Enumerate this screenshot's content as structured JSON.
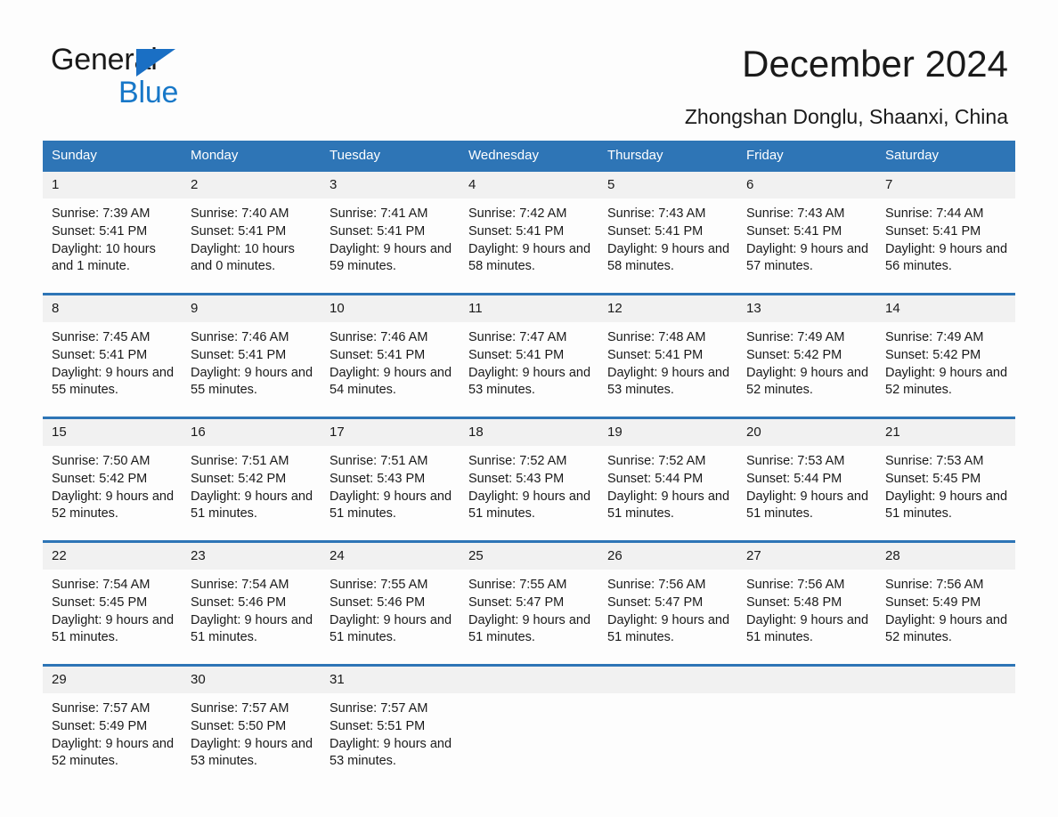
{
  "logo": {
    "word1": "General",
    "word2": "Blue",
    "triangle_color": "#1a6fc4",
    "word2_color": "#1878c8"
  },
  "header": {
    "title": "December 2024",
    "subtitle": "Zhongshan Donglu, Shaanxi, China"
  },
  "theme": {
    "header_band": "#2e75b6",
    "daynum_background": "#f1f1f1",
    "page_background": "#fdfdfd",
    "text": "#1a1a1a"
  },
  "calendar": {
    "weekday_headers": [
      "Sunday",
      "Monday",
      "Tuesday",
      "Wednesday",
      "Thursday",
      "Friday",
      "Saturday"
    ],
    "weeks": [
      [
        {
          "day": "1",
          "sunrise": "Sunrise: 7:39 AM",
          "sunset": "Sunset: 5:41 PM",
          "daylight": "Daylight: 10 hours and 1 minute."
        },
        {
          "day": "2",
          "sunrise": "Sunrise: 7:40 AM",
          "sunset": "Sunset: 5:41 PM",
          "daylight": "Daylight: 10 hours and 0 minutes."
        },
        {
          "day": "3",
          "sunrise": "Sunrise: 7:41 AM",
          "sunset": "Sunset: 5:41 PM",
          "daylight": "Daylight: 9 hours and 59 minutes."
        },
        {
          "day": "4",
          "sunrise": "Sunrise: 7:42 AM",
          "sunset": "Sunset: 5:41 PM",
          "daylight": "Daylight: 9 hours and 58 minutes."
        },
        {
          "day": "5",
          "sunrise": "Sunrise: 7:43 AM",
          "sunset": "Sunset: 5:41 PM",
          "daylight": "Daylight: 9 hours and 58 minutes."
        },
        {
          "day": "6",
          "sunrise": "Sunrise: 7:43 AM",
          "sunset": "Sunset: 5:41 PM",
          "daylight": "Daylight: 9 hours and 57 minutes."
        },
        {
          "day": "7",
          "sunrise": "Sunrise: 7:44 AM",
          "sunset": "Sunset: 5:41 PM",
          "daylight": "Daylight: 9 hours and 56 minutes."
        }
      ],
      [
        {
          "day": "8",
          "sunrise": "Sunrise: 7:45 AM",
          "sunset": "Sunset: 5:41 PM",
          "daylight": "Daylight: 9 hours and 55 minutes."
        },
        {
          "day": "9",
          "sunrise": "Sunrise: 7:46 AM",
          "sunset": "Sunset: 5:41 PM",
          "daylight": "Daylight: 9 hours and 55 minutes."
        },
        {
          "day": "10",
          "sunrise": "Sunrise: 7:46 AM",
          "sunset": "Sunset: 5:41 PM",
          "daylight": "Daylight: 9 hours and 54 minutes."
        },
        {
          "day": "11",
          "sunrise": "Sunrise: 7:47 AM",
          "sunset": "Sunset: 5:41 PM",
          "daylight": "Daylight: 9 hours and 53 minutes."
        },
        {
          "day": "12",
          "sunrise": "Sunrise: 7:48 AM",
          "sunset": "Sunset: 5:41 PM",
          "daylight": "Daylight: 9 hours and 53 minutes."
        },
        {
          "day": "13",
          "sunrise": "Sunrise: 7:49 AM",
          "sunset": "Sunset: 5:42 PM",
          "daylight": "Daylight: 9 hours and 52 minutes."
        },
        {
          "day": "14",
          "sunrise": "Sunrise: 7:49 AM",
          "sunset": "Sunset: 5:42 PM",
          "daylight": "Daylight: 9 hours and 52 minutes."
        }
      ],
      [
        {
          "day": "15",
          "sunrise": "Sunrise: 7:50 AM",
          "sunset": "Sunset: 5:42 PM",
          "daylight": "Daylight: 9 hours and 52 minutes."
        },
        {
          "day": "16",
          "sunrise": "Sunrise: 7:51 AM",
          "sunset": "Sunset: 5:42 PM",
          "daylight": "Daylight: 9 hours and 51 minutes."
        },
        {
          "day": "17",
          "sunrise": "Sunrise: 7:51 AM",
          "sunset": "Sunset: 5:43 PM",
          "daylight": "Daylight: 9 hours and 51 minutes."
        },
        {
          "day": "18",
          "sunrise": "Sunrise: 7:52 AM",
          "sunset": "Sunset: 5:43 PM",
          "daylight": "Daylight: 9 hours and 51 minutes."
        },
        {
          "day": "19",
          "sunrise": "Sunrise: 7:52 AM",
          "sunset": "Sunset: 5:44 PM",
          "daylight": "Daylight: 9 hours and 51 minutes."
        },
        {
          "day": "20",
          "sunrise": "Sunrise: 7:53 AM",
          "sunset": "Sunset: 5:44 PM",
          "daylight": "Daylight: 9 hours and 51 minutes."
        },
        {
          "day": "21",
          "sunrise": "Sunrise: 7:53 AM",
          "sunset": "Sunset: 5:45 PM",
          "daylight": "Daylight: 9 hours and 51 minutes."
        }
      ],
      [
        {
          "day": "22",
          "sunrise": "Sunrise: 7:54 AM",
          "sunset": "Sunset: 5:45 PM",
          "daylight": "Daylight: 9 hours and 51 minutes."
        },
        {
          "day": "23",
          "sunrise": "Sunrise: 7:54 AM",
          "sunset": "Sunset: 5:46 PM",
          "daylight": "Daylight: 9 hours and 51 minutes."
        },
        {
          "day": "24",
          "sunrise": "Sunrise: 7:55 AM",
          "sunset": "Sunset: 5:46 PM",
          "daylight": "Daylight: 9 hours and 51 minutes."
        },
        {
          "day": "25",
          "sunrise": "Sunrise: 7:55 AM",
          "sunset": "Sunset: 5:47 PM",
          "daylight": "Daylight: 9 hours and 51 minutes."
        },
        {
          "day": "26",
          "sunrise": "Sunrise: 7:56 AM",
          "sunset": "Sunset: 5:47 PM",
          "daylight": "Daylight: 9 hours and 51 minutes."
        },
        {
          "day": "27",
          "sunrise": "Sunrise: 7:56 AM",
          "sunset": "Sunset: 5:48 PM",
          "daylight": "Daylight: 9 hours and 51 minutes."
        },
        {
          "day": "28",
          "sunrise": "Sunrise: 7:56 AM",
          "sunset": "Sunset: 5:49 PM",
          "daylight": "Daylight: 9 hours and 52 minutes."
        }
      ],
      [
        {
          "day": "29",
          "sunrise": "Sunrise: 7:57 AM",
          "sunset": "Sunset: 5:49 PM",
          "daylight": "Daylight: 9 hours and 52 minutes."
        },
        {
          "day": "30",
          "sunrise": "Sunrise: 7:57 AM",
          "sunset": "Sunset: 5:50 PM",
          "daylight": "Daylight: 9 hours and 53 minutes."
        },
        {
          "day": "31",
          "sunrise": "Sunrise: 7:57 AM",
          "sunset": "Sunset: 5:51 PM",
          "daylight": "Daylight: 9 hours and 53 minutes."
        },
        {
          "day": "",
          "sunrise": "",
          "sunset": "",
          "daylight": ""
        },
        {
          "day": "",
          "sunrise": "",
          "sunset": "",
          "daylight": ""
        },
        {
          "day": "",
          "sunrise": "",
          "sunset": "",
          "daylight": ""
        },
        {
          "day": "",
          "sunrise": "",
          "sunset": "",
          "daylight": ""
        }
      ]
    ]
  }
}
